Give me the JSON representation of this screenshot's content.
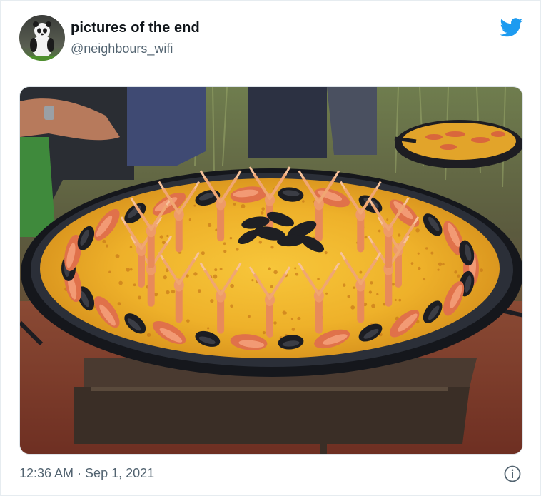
{
  "tweet": {
    "display_name": "pictures of the end",
    "handle": "@neighbours_wifi",
    "timestamp": "12:36 AM · Sep 1, 2021"
  },
  "media": {
    "subject": "paella pan with langoustines, prawns and mussels"
  },
  "colors": {
    "twitter_blue": "#1d9bf0",
    "text_primary": "#0f1419",
    "text_secondary": "#536471"
  },
  "icons": [
    "twitter-bird-icon",
    "info-icon"
  ]
}
